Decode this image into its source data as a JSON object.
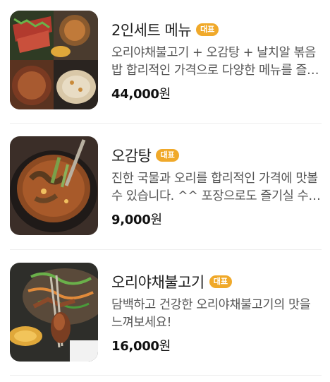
{
  "menu": [
    {
      "name": "2인세트 메뉴",
      "badge": "대표",
      "description": "오리야채불고기 + 오감탕 + 날치알 볶음밥 합리적인 가격으로 다양한 메뉴를 즐기실 수 있습니다.",
      "price_number": "44,000",
      "price_unit": "원"
    },
    {
      "name": "오감탕",
      "badge": "대표",
      "description": "진한 국물과 오리를 합리적인 가격에 맛볼 수 있습니다. ^^ 포장으로도 즐기실 수 있습니다.",
      "price_number": "9,000",
      "price_unit": "원"
    },
    {
      "name": "오리야채불고기",
      "badge": "대표",
      "description": "담백하고 건강한 오리야채불고기의 맛을 느껴보세요!",
      "price_number": "16,000",
      "price_unit": "원"
    }
  ]
}
